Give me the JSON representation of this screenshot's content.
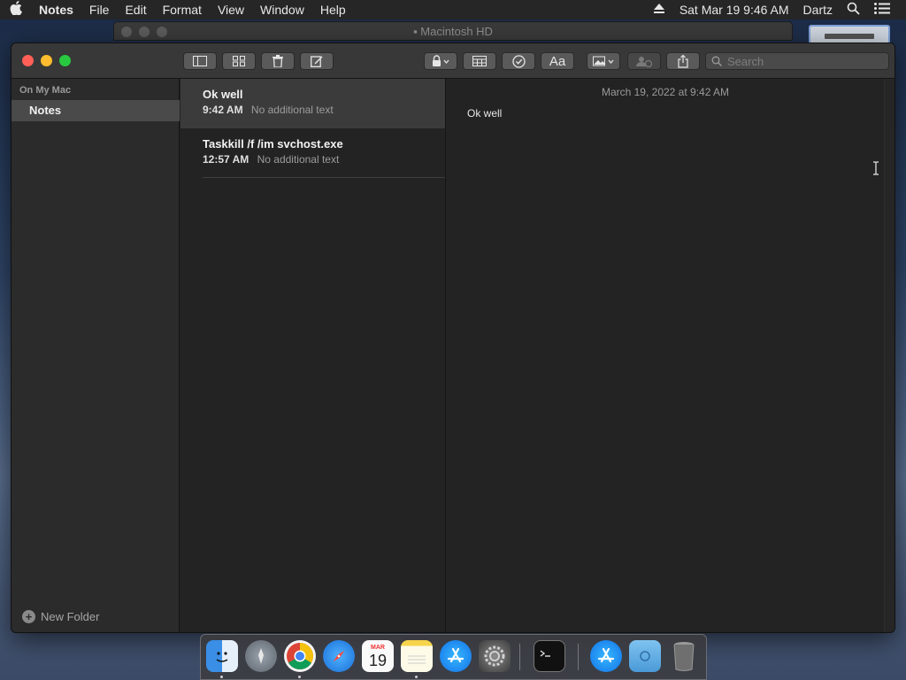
{
  "menubar": {
    "apple_icon": "apple-logo-icon",
    "app_name": "Notes",
    "menus": [
      "File",
      "Edit",
      "Format",
      "View",
      "Window",
      "Help"
    ],
    "date_time": "Sat Mar 19  9:46 AM",
    "user": "Dartz"
  },
  "background_window": {
    "title": "Macintosh HD"
  },
  "toolbar": {
    "search_placeholder": "Search"
  },
  "sidebar": {
    "section": "On My Mac",
    "folder": "Notes",
    "new_folder_label": "New Folder"
  },
  "notes": [
    {
      "title": "Ok well",
      "time": "9:42 AM",
      "preview": "No additional text",
      "selected": true
    },
    {
      "title": "Taskkill /f /im svchost.exe",
      "time": "12:57 AM",
      "preview": "No additional text",
      "selected": false
    }
  ],
  "editor": {
    "date": "March 19, 2022 at 9:42 AM",
    "body": "Ok well"
  },
  "dock": {
    "calendar_month": "MAR",
    "calendar_day": "19"
  },
  "colors": {
    "close": "#ff5f57",
    "minimize": "#febc2e",
    "zoom": "#28c840"
  }
}
